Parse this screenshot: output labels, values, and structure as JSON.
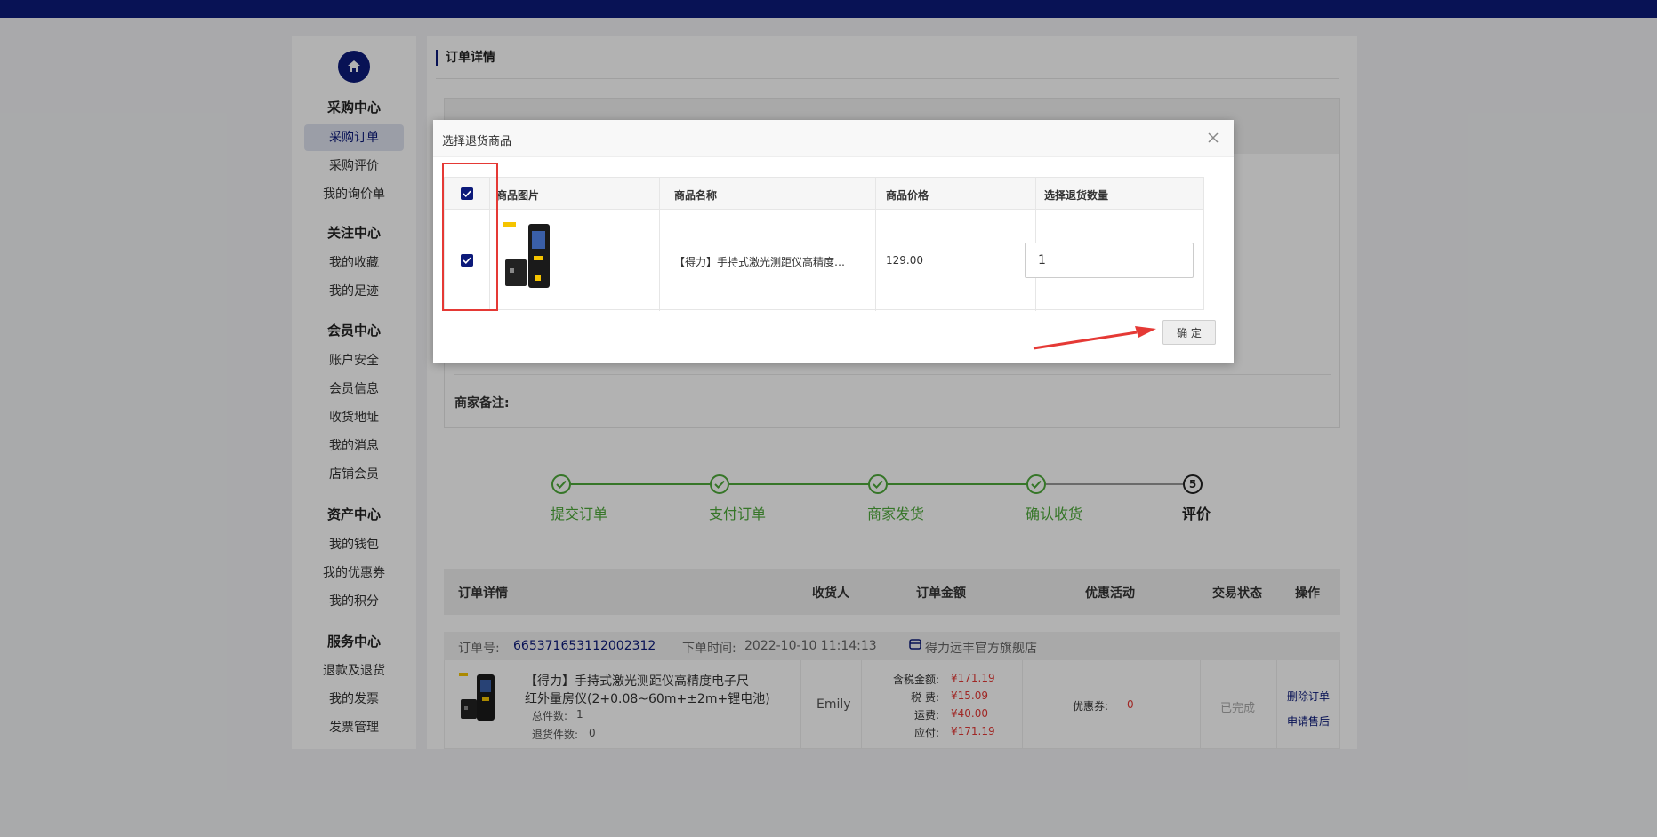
{
  "sidebar": {
    "groups": [
      {
        "title": "采购中心",
        "items": [
          "采购订单",
          "采购评价",
          "我的询价单"
        ]
      },
      {
        "title": "关注中心",
        "items": [
          "我的收藏",
          "我的足迹"
        ]
      },
      {
        "title": "会员中心",
        "items": [
          "账户安全",
          "会员信息",
          "收货地址",
          "我的消息",
          "店铺会员"
        ]
      },
      {
        "title": "资产中心",
        "items": [
          "我的钱包",
          "我的优惠券",
          "我的积分"
        ]
      },
      {
        "title": "服务中心",
        "items": [
          "退款及退货",
          "我的发票",
          "发票管理"
        ]
      }
    ]
  },
  "main": {
    "section_title": "订单详情",
    "merchant_note_label": "商家备注:"
  },
  "steps": [
    "提交订单",
    "支付订单",
    "商家发货",
    "确认收货",
    "评价"
  ],
  "current_step_number": "5",
  "order_table": {
    "headers": [
      "订单详情",
      "收货人",
      "订单金额",
      "优惠活动",
      "交易状态",
      "操作"
    ],
    "order_no_label": "订单号:",
    "order_no": "665371653112002312",
    "order_time_label": "下单时间:",
    "order_time": "2022-10-10 11:14:13",
    "shop_name": "得力远丰官方旗舰店",
    "product_title_line1": "【得力】手持式激光测距仪高精度电子尺",
    "product_title_line2": "红外量房仪(2+0.08~60m+±2m+锂电池)",
    "total_count_label": "总件数:",
    "total_count": "1",
    "return_count_label": "退货件数:",
    "return_count": "0",
    "receiver": "Emily",
    "amounts": [
      {
        "label": "含税金额:",
        "value": "¥171.19"
      },
      {
        "label": "税 费:",
        "value": "¥15.09"
      },
      {
        "label": "运费:",
        "value": "¥40.00"
      },
      {
        "label": "应付:",
        "value": "¥171.19"
      }
    ],
    "coupon_label": "优惠券:",
    "coupon_value": "0",
    "status": "已完成",
    "actions": [
      "删除订单",
      "申请售后"
    ]
  },
  "modal": {
    "title": "选择退货商品",
    "headers": [
      "商品图片",
      "商品名称",
      "商品价格",
      "选择退货数量"
    ],
    "product_name": "【得力】手持式激光测距仪高精度电子尺红外量房仪(2+0.08~60m+±2m+锂电池)",
    "price": "129.00",
    "quantity": "1",
    "confirm_label": "确 定",
    "header_checked": true,
    "row_checked": true
  },
  "colors": {
    "brand": "#0c1a7a",
    "step_done": "#4ea93a",
    "price_red": "#e53935",
    "annotation_red": "#e53935"
  }
}
